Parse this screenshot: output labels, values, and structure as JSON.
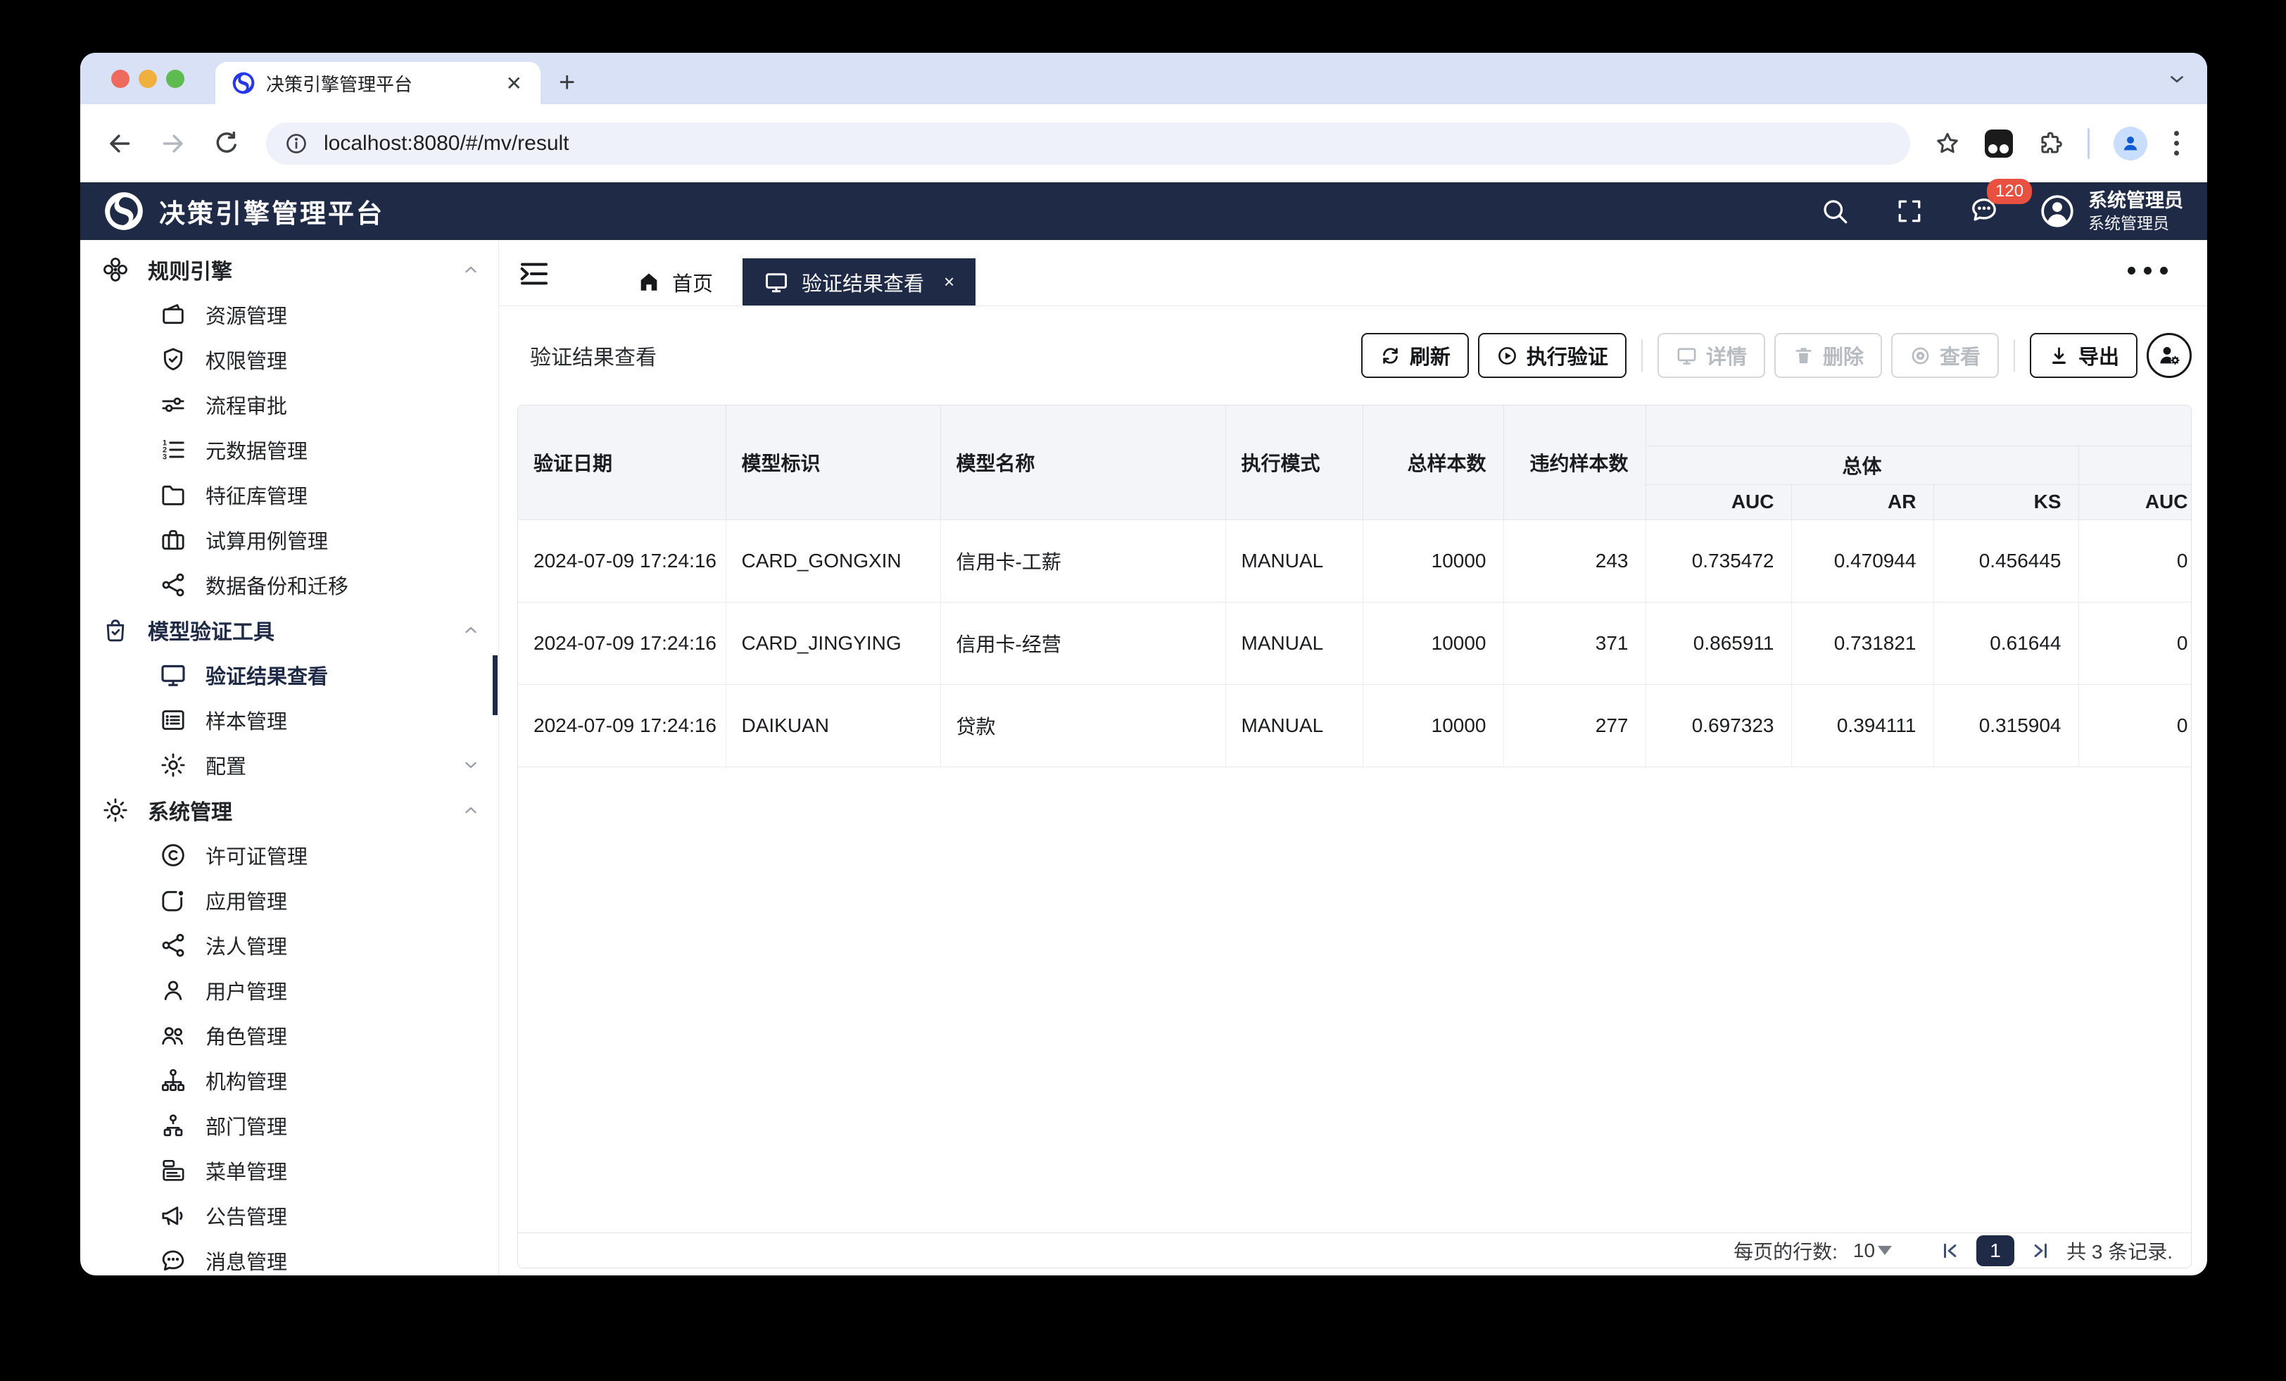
{
  "browser": {
    "tab_title": "决策引擎管理平台",
    "url": "localhost:8080/#/mv/result"
  },
  "header": {
    "app_title": "决策引擎管理平台",
    "badge_count": "120",
    "user_name": "系统管理员",
    "user_role": "系统管理员",
    "navy_color": "#1f2a47",
    "badge_color": "#e8503f"
  },
  "sidebar": {
    "items": [
      {
        "label": "规则引擎"
      },
      {
        "label": "资源管理"
      },
      {
        "label": "权限管理"
      },
      {
        "label": "流程审批"
      },
      {
        "label": "元数据管理"
      },
      {
        "label": "特征库管理"
      },
      {
        "label": "试算用例管理"
      },
      {
        "label": "数据备份和迁移"
      },
      {
        "label": "模型验证工具"
      },
      {
        "label": "验证结果查看"
      },
      {
        "label": "样本管理"
      },
      {
        "label": "配置"
      },
      {
        "label": "系统管理"
      },
      {
        "label": "许可证管理"
      },
      {
        "label": "应用管理"
      },
      {
        "label": "法人管理"
      },
      {
        "label": "用户管理"
      },
      {
        "label": "角色管理"
      },
      {
        "label": "机构管理"
      },
      {
        "label": "部门管理"
      },
      {
        "label": "菜单管理"
      },
      {
        "label": "公告管理"
      },
      {
        "label": "消息管理"
      }
    ]
  },
  "tabs": {
    "home": "首页",
    "active": "验证结果查看",
    "close": "×"
  },
  "page": {
    "title": "验证结果查看"
  },
  "toolbar": {
    "refresh": "刷新",
    "run": "执行验证",
    "detail": "详情",
    "delete": "删除",
    "view": "查看",
    "export": "导出"
  },
  "table": {
    "headers": {
      "date": "验证日期",
      "model_id": "模型标识",
      "model_name": "模型名称",
      "mode": "执行模式",
      "total_samples": "总样本数",
      "default_samples": "违约样本数",
      "group_overall": "总体",
      "auc": "AUC",
      "ar": "AR",
      "ks": "KS",
      "auc2": "AUC"
    },
    "rows": [
      [
        "2024-07-09 17:24:16",
        "CARD_GONGXIN",
        "信用卡-工薪",
        "MANUAL",
        "10000",
        "243",
        "0.735472",
        "0.470944",
        "0.456445",
        "0"
      ],
      [
        "2024-07-09 17:24:16",
        "CARD_JINGYING",
        "信用卡-经营",
        "MANUAL",
        "10000",
        "371",
        "0.865911",
        "0.731821",
        "0.61644",
        "0"
      ],
      [
        "2024-07-09 17:24:16",
        "DAIKUAN",
        "贷款",
        "MANUAL",
        "10000",
        "277",
        "0.697323",
        "0.394111",
        "0.315904",
        "0"
      ]
    ]
  },
  "pagination": {
    "rows_per_page_label": "每页的行数:",
    "rows_per_page": "10",
    "page": "1",
    "total_label": "共 3 条记录."
  }
}
